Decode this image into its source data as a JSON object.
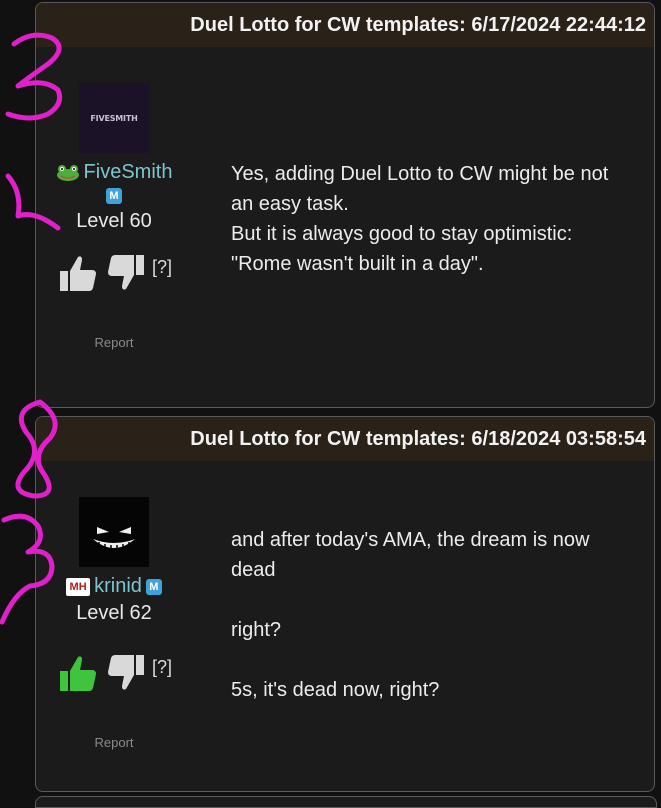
{
  "posts": [
    {
      "title": "Duel Lotto for CW templates: 6/17/2024 22:44:12",
      "avatar_text": "FIVESMITH",
      "author": "FiveSmith",
      "level": "Level 60",
      "help": "[?]",
      "report": "Report",
      "lines": [
        "Yes, adding Duel Lotto to CW might be not",
        "an easy task.",
        "But it is always good to stay optimistic:",
        "\"Rome wasn't built in a day\"."
      ]
    },
    {
      "title": "Duel Lotto for CW templates: 6/18/2024 03:58:54",
      "author": "krinid",
      "badge": "MH",
      "level": "Level 62",
      "help": "[?]",
      "report": "Report",
      "lines": [
        "and after today's AMA, the dream is now",
        "dead",
        "",
        "right?",
        "",
        "5s, it's dead now, right?"
      ]
    }
  ],
  "flair_letter": "M",
  "colors": {
    "background": "#111111",
    "card": "#1b1b1b",
    "header": "#2a2119",
    "username": "#7ec4cf",
    "upvote_active": "#3ec43e",
    "vote_idle": "#d9d9d9",
    "annotation": "#e020c8"
  }
}
